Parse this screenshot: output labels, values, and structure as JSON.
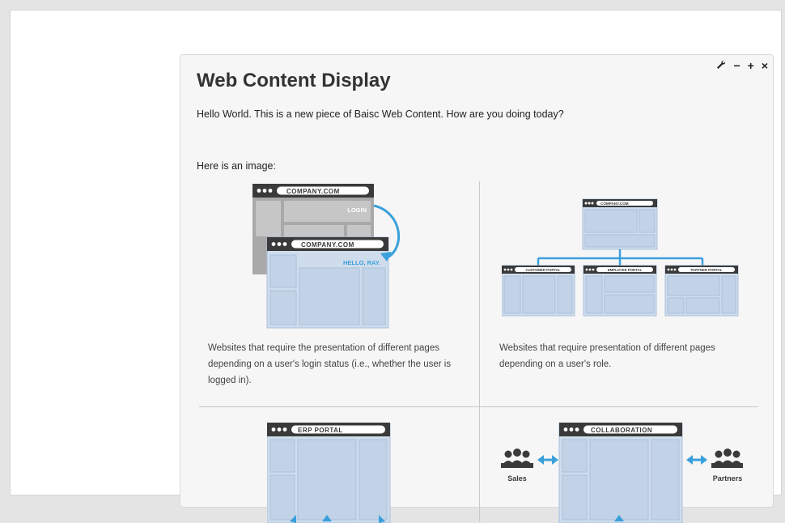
{
  "portlet": {
    "title": "Web Content Display",
    "controls": {
      "config": "✚",
      "minimize": "−",
      "maximize": "+",
      "close": "×"
    }
  },
  "content": {
    "intro": "Hello World. This is a new piece of Baisc Web Content. How are you doing today?",
    "image_label": "Here is an image:"
  },
  "cells": [
    {
      "caption": "Websites that require the presentation of different pages depending on a user's login status (i.e., whether the user is logged in).",
      "browser_back": "COMPANY.COM",
      "back_text": "LOGIN",
      "browser_front": "COMPANY.COM",
      "front_text": "HELLO, RAY."
    },
    {
      "caption": "Websites that require presentation of different pages depending on a user's role.",
      "browser_top": "COMPANY.COM",
      "portals": [
        "CUSTOMER PORTAL",
        "EMPLOYEE PORTAL",
        "PARTNER PORTAL"
      ]
    },
    {
      "browser": "ERP PORTAL"
    },
    {
      "browser": "COLLABORATION",
      "left_group": "Sales",
      "right_group": "Partners"
    }
  ],
  "colors": {
    "page_bg": "#e4e4e4",
    "portlet_bg": "#f6f6f6",
    "browser_bar": "#3a3a3a",
    "panel_blue": "#cfdcec",
    "panel_blue_border": "#a9c0db",
    "panel_grey": "#a9a9a9",
    "accent_blue": "#3aa0dc"
  }
}
